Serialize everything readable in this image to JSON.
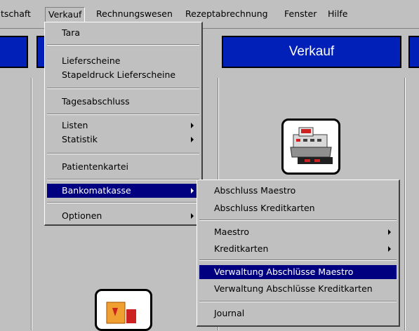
{
  "menubar": {
    "items": [
      "tschaft",
      "Verkauf",
      "Rechnungswesen",
      "Rezeptabrechnung",
      "Fenster",
      "Hilfe"
    ]
  },
  "panels": {
    "verkauf_title": "Verkauf"
  },
  "verkauf_menu": {
    "items": [
      "Tara",
      "Lieferscheine",
      "Stapeldruck Lieferscheine",
      "Tagesabschluss",
      "Listen",
      "Statistik",
      "Patientenkartei",
      "Bankomatkasse",
      "Optionen"
    ]
  },
  "bankomat_submenu": {
    "items": [
      "Abschluss Maestro",
      "Abschluss Kreditkarten",
      "Maestro",
      "Kreditkarten",
      "Verwaltung Abschlüsse Maestro",
      "Verwaltung Abschlüsse Kreditkarten",
      "Journal"
    ]
  },
  "icons": [
    "cash-register-icon",
    "delivery-truck-icon"
  ],
  "colors": {
    "header_blue": "#0020b8",
    "highlight": "#000080",
    "background": "#c0c0c0"
  }
}
